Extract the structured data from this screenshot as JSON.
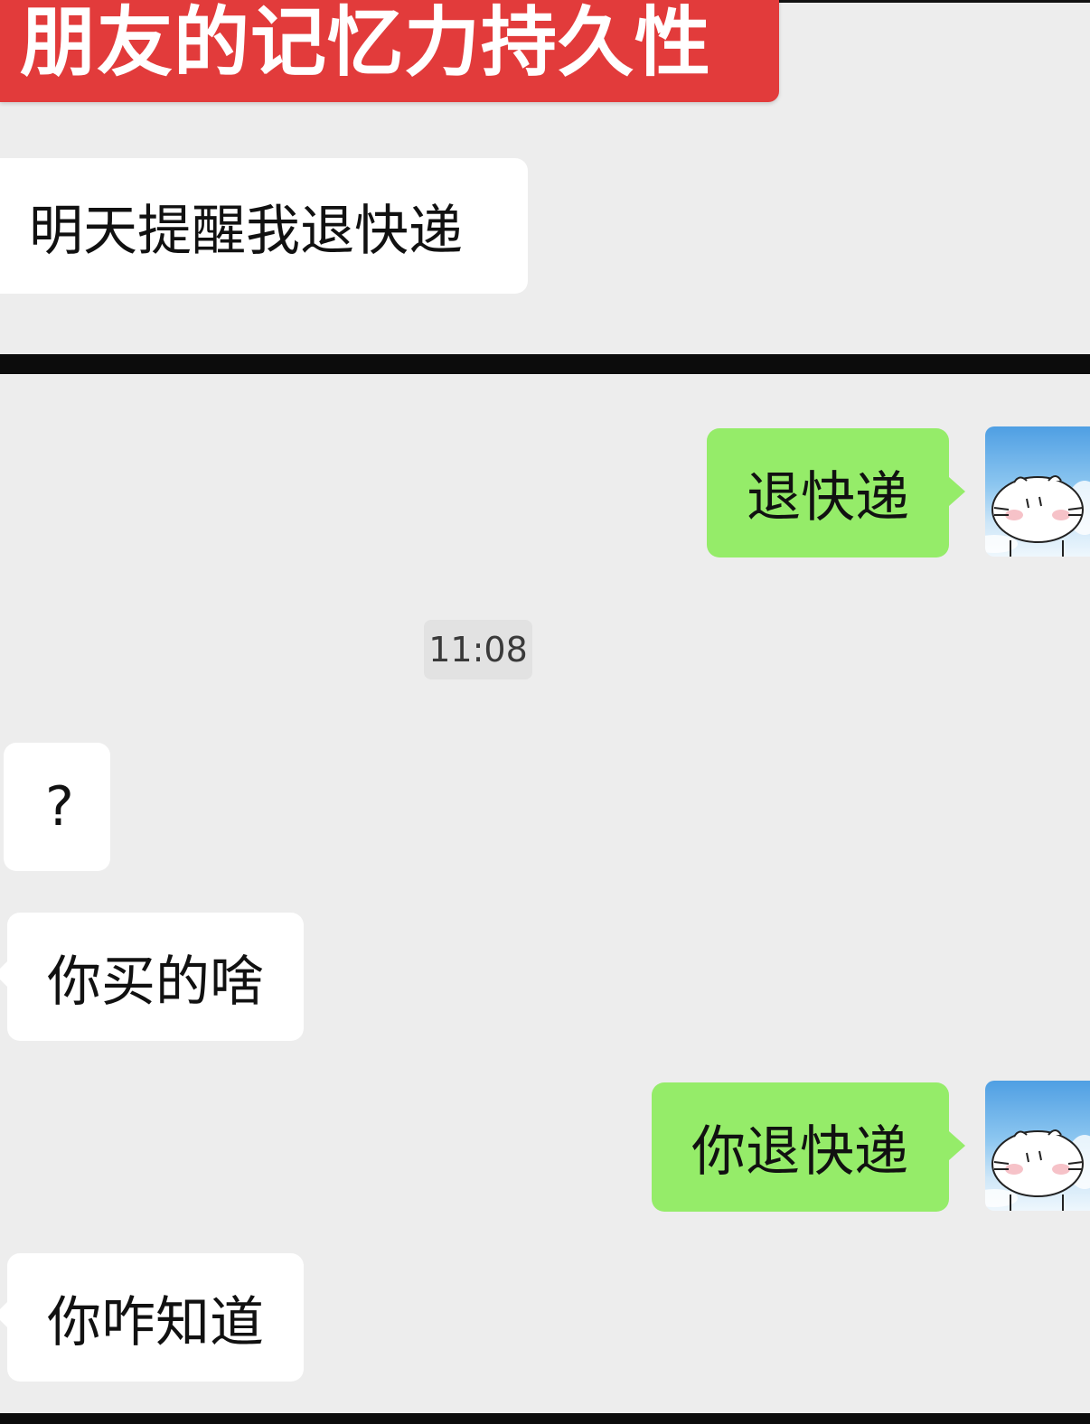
{
  "title_banner": {
    "text": "朋友的记忆力持久性",
    "color": "#e23b3b"
  },
  "top_panel": {
    "incoming_message": "明天提醒我退快递"
  },
  "chat": {
    "messages": [
      {
        "direction": "outgoing",
        "text": "退快递"
      },
      {
        "direction": "incoming",
        "text": "?"
      },
      {
        "direction": "incoming",
        "text": "你买的啥"
      },
      {
        "direction": "outgoing",
        "text": "你退快递"
      },
      {
        "direction": "incoming",
        "text": "你咋知道"
      }
    ],
    "timestamp": "11:08"
  },
  "colors": {
    "background": "#ededed",
    "outgoing_bubble": "#95ec69",
    "incoming_bubble": "#ffffff",
    "divider": "#0c0c0c"
  },
  "avatar": {
    "icon": "cartoon-cat-avatar-icon"
  }
}
